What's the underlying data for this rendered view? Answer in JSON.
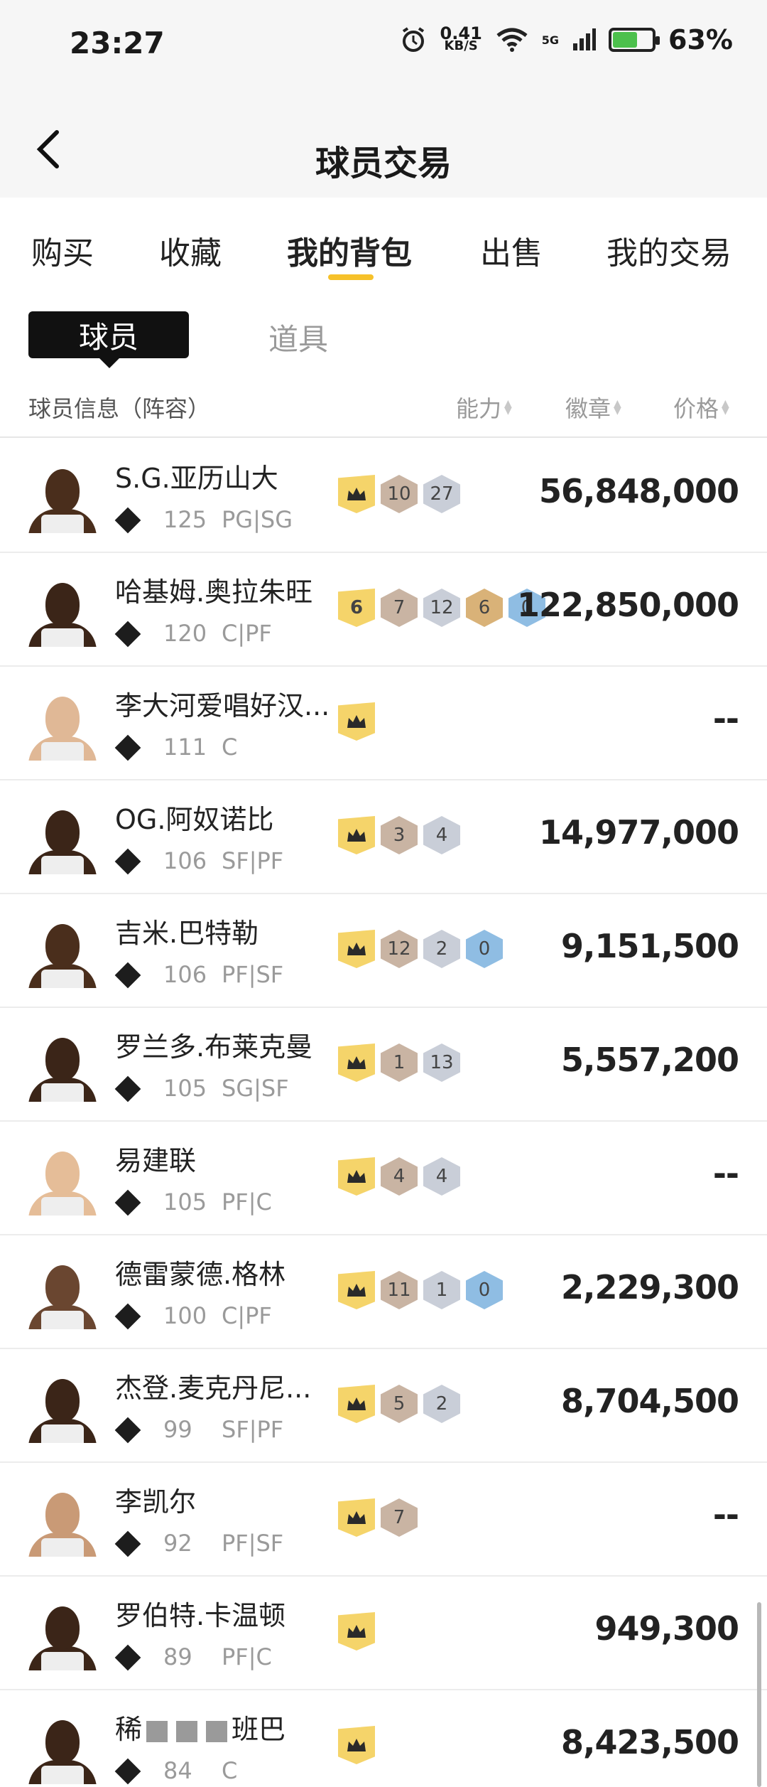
{
  "status_bar": {
    "time": "23:27",
    "net_speed": "0.41",
    "net_unit": "KB/S",
    "network": "5G",
    "battery": "63%",
    "battery_level": 0.63
  },
  "header": {
    "title": "球员交易"
  },
  "tabs": [
    {
      "label": "购买"
    },
    {
      "label": "收藏"
    },
    {
      "label": "我的背包",
      "active": true
    },
    {
      "label": "出售"
    },
    {
      "label": "我的交易"
    }
  ],
  "subtabs": {
    "players": "球员",
    "items": "道具"
  },
  "columns": {
    "info": "球员信息（阵容）",
    "ability": "能力",
    "badges": "徽章",
    "price": "价格"
  },
  "players": [
    {
      "name": "S.G.亚历山大",
      "rating": "125",
      "position": "PG|SG",
      "badges": [
        {
          "type": "crown"
        },
        {
          "type": "bronze",
          "v": "10"
        },
        {
          "type": "silver",
          "v": "27"
        }
      ],
      "price": "56,848,000",
      "skin": "#4a2e1c"
    },
    {
      "name": "哈基姆.奥拉朱旺",
      "rating": "120",
      "position": "C|PF",
      "badges": [
        {
          "type": "crown-num",
          "v": "6"
        },
        {
          "type": "bronze",
          "v": "7"
        },
        {
          "type": "silver",
          "v": "12"
        },
        {
          "type": "gold",
          "v": "6"
        },
        {
          "type": "blue",
          "v": "0"
        }
      ],
      "price": "122,850,000",
      "skin": "#3b2518"
    },
    {
      "name": "李大河爱唱好汉...",
      "rating": "111",
      "position": "C",
      "badges": [
        {
          "type": "crown"
        }
      ],
      "price": "--",
      "skin": "#e0b896"
    },
    {
      "name": "OG.阿奴诺比",
      "rating": "106",
      "position": "SF|PF",
      "badges": [
        {
          "type": "crown"
        },
        {
          "type": "bronze",
          "v": "3"
        },
        {
          "type": "silver",
          "v": "4"
        }
      ],
      "price": "14,977,000",
      "skin": "#3b2518"
    },
    {
      "name": "吉米.巴特勒",
      "rating": "106",
      "position": "PF|SF",
      "badges": [
        {
          "type": "crown"
        },
        {
          "type": "bronze",
          "v": "12"
        },
        {
          "type": "silver",
          "v": "2"
        },
        {
          "type": "blue",
          "v": "0"
        }
      ],
      "price": "9,151,500",
      "skin": "#4a2e1c"
    },
    {
      "name": "罗兰多.布莱克曼",
      "rating": "105",
      "position": "SG|SF",
      "badges": [
        {
          "type": "crown"
        },
        {
          "type": "bronze",
          "v": "1"
        },
        {
          "type": "silver",
          "v": "13"
        }
      ],
      "price": "5,557,200",
      "skin": "#3b2518"
    },
    {
      "name": "易建联",
      "rating": "105",
      "position": "PF|C",
      "badges": [
        {
          "type": "crown"
        },
        {
          "type": "bronze",
          "v": "4"
        },
        {
          "type": "silver",
          "v": "4"
        }
      ],
      "price": "--",
      "skin": "#e5bd98"
    },
    {
      "name": "德雷蒙德.格林",
      "rating": "100",
      "position": "C|PF",
      "badges": [
        {
          "type": "crown"
        },
        {
          "type": "bronze",
          "v": "11"
        },
        {
          "type": "silver",
          "v": "1"
        },
        {
          "type": "blue",
          "v": "0"
        }
      ],
      "price": "2,229,300",
      "skin": "#6a4630"
    },
    {
      "name": "杰登.麦克丹尼...",
      "rating": "99",
      "position": "SF|PF",
      "badges": [
        {
          "type": "crown"
        },
        {
          "type": "bronze",
          "v": "5"
        },
        {
          "type": "silver",
          "v": "2"
        }
      ],
      "price": "8,704,500",
      "skin": "#3b2518"
    },
    {
      "name": "李凯尔",
      "rating": "92",
      "position": "PF|SF",
      "badges": [
        {
          "type": "crown"
        },
        {
          "type": "bronze",
          "v": "7"
        }
      ],
      "price": "--",
      "skin": "#c99a76"
    },
    {
      "name": "罗伯特.卡温顿",
      "rating": "89",
      "position": "PF|C",
      "badges": [
        {
          "type": "crown"
        }
      ],
      "price": "949,300",
      "skin": "#3b2518"
    },
    {
      "name": "稀",
      "name_suffix": "班巴",
      "rating": "84",
      "position": "C",
      "badges": [
        {
          "type": "crown"
        }
      ],
      "price": "8,423,500",
      "skin": "#3b2518",
      "obscured": true
    }
  ]
}
